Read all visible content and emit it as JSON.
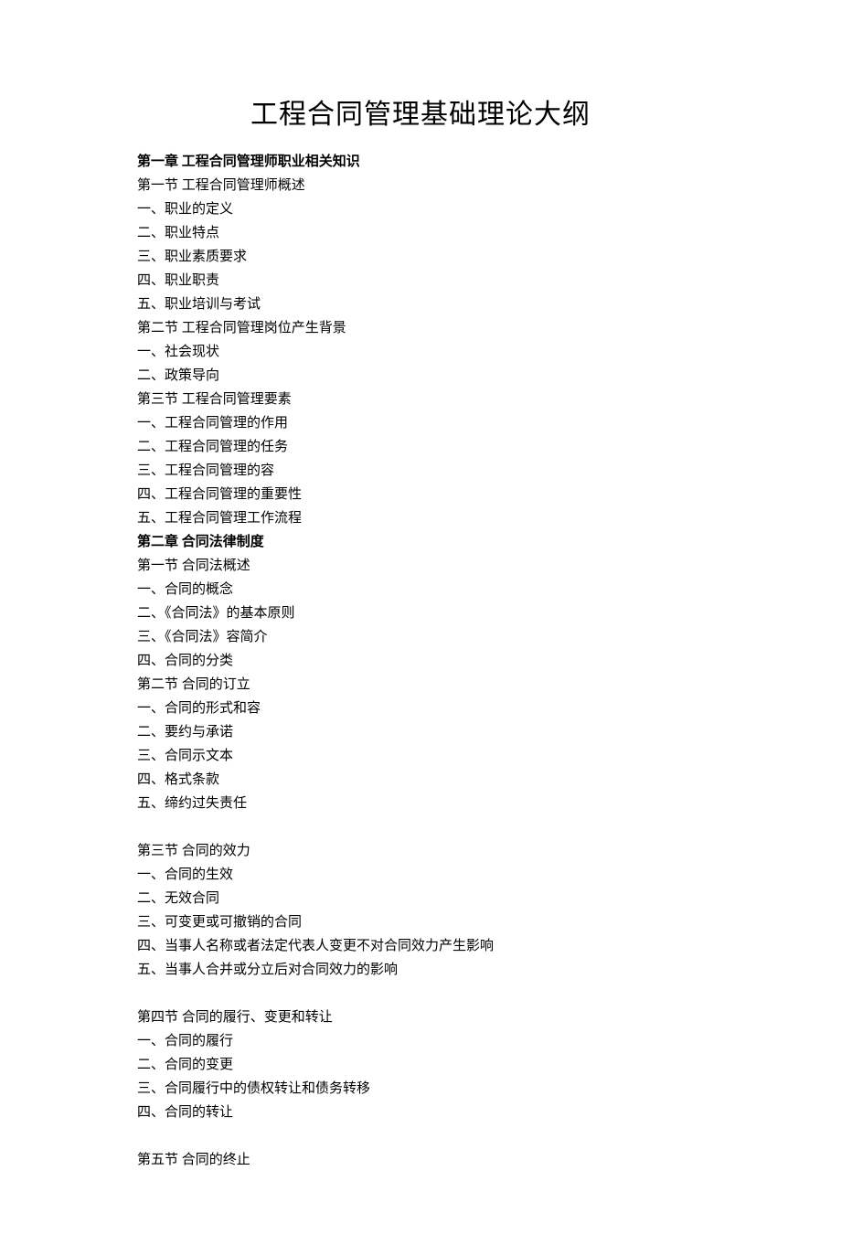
{
  "title": "工程合同管理基础理论大纲",
  "lines": [
    {
      "text": "第一章   工程合同管理师职业相关知识",
      "bold": true
    },
    {
      "text": "第一节   工程合同管理师概述"
    },
    {
      "text": "一、职业的定义"
    },
    {
      "text": "二、职业特点"
    },
    {
      "text": "三、职业素质要求"
    },
    {
      "text": "四、职业职责"
    },
    {
      "text": "五、职业培训与考试"
    },
    {
      "text": "第二节   工程合同管理岗位产生背景"
    },
    {
      "text": "一、社会现状"
    },
    {
      "text": "二、政策导向"
    },
    {
      "text": "第三节   工程合同管理要素"
    },
    {
      "text": "一、工程合同管理的作用"
    },
    {
      "text": "二、工程合同管理的任务"
    },
    {
      "text": "三、工程合同管理的容"
    },
    {
      "text": "四、工程合同管理的重要性"
    },
    {
      "text": "五、工程合同管理工作流程"
    },
    {
      "text": "第二章   合同法律制度",
      "bold": true
    },
    {
      "text": "第一节   合同法概述"
    },
    {
      "text": "一、合同的概念"
    },
    {
      "text": "二、《合同法》的基本原则"
    },
    {
      "text": "三、《合同法》容简介"
    },
    {
      "text": "四、合同的分类"
    },
    {
      "text": "第二节   合同的订立"
    },
    {
      "text": "一、合同的形式和容"
    },
    {
      "text": "二、要约与承诺"
    },
    {
      "text": "三、合同示文本"
    },
    {
      "text": "四、格式条款"
    },
    {
      "text": "五、缔约过失责任"
    },
    {
      "text": "",
      "spacer": true
    },
    {
      "text": "第三节   合同的效力"
    },
    {
      "text": "一、合同的生效"
    },
    {
      "text": "二、无效合同"
    },
    {
      "text": "三、可变更或可撤销的合同"
    },
    {
      "text": "四、当事人名称或者法定代表人变更不对合同效力产生影响"
    },
    {
      "text": "五、当事人合并或分立后对合同效力的影响"
    },
    {
      "text": "",
      "spacer": true
    },
    {
      "text": "第四节   合同的履行、变更和转让"
    },
    {
      "text": "一、合同的履行"
    },
    {
      "text": "二、合同的变更"
    },
    {
      "text": "三、合同履行中的债权转让和债务转移"
    },
    {
      "text": "四、合同的转让"
    },
    {
      "text": "",
      "spacer": true
    },
    {
      "text": "第五节   合同的终止"
    }
  ]
}
